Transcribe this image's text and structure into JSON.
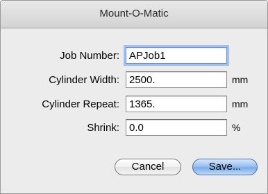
{
  "window": {
    "title": "Mount-O-Matic"
  },
  "form": {
    "job_number": {
      "label": "Job Number:",
      "value": "APJob1"
    },
    "cylinder_width": {
      "label": "Cylinder Width:",
      "value": "2500.",
      "unit": "mm"
    },
    "cylinder_repeat": {
      "label": "Cylinder Repeat:",
      "value": "1365.",
      "unit": "mm"
    },
    "shrink": {
      "label": "Shrink:",
      "value": "0.0",
      "unit": "%"
    }
  },
  "buttons": {
    "cancel_label": "Cancel",
    "save_label": "Save..."
  }
}
